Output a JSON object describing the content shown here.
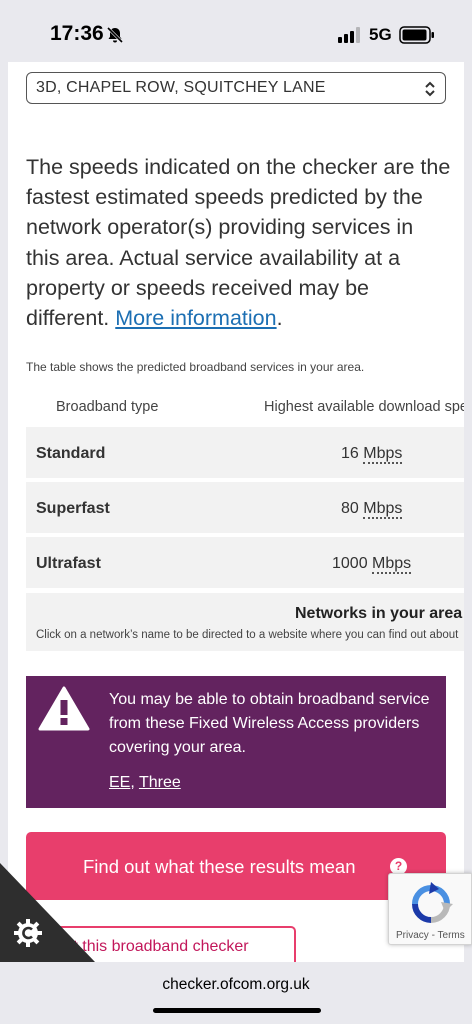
{
  "status_bar": {
    "time": "17:36",
    "network": "5G",
    "icons": [
      "bell-off-icon",
      "signal-icon",
      "battery-icon"
    ]
  },
  "address_select": {
    "value": "3D, CHAPEL ROW, SQUITCHEY LANE"
  },
  "intro": {
    "text": "The speeds indicated on the checker are the fastest estimated speeds predicted by the network operator(s) providing services in this area. Actual service availability at a property or speeds received may be different.",
    "link": "More information",
    "trailing": "."
  },
  "table": {
    "caption": "The table shows the predicted broadband services in your area.",
    "headers": [
      "Broadband type",
      "Highest available download speed"
    ],
    "rows": [
      {
        "type": "Standard",
        "speed": "16",
        "unit": "Mbps"
      },
      {
        "type": "Superfast",
        "speed": "80",
        "unit": "Mbps"
      },
      {
        "type": "Ultrafast",
        "speed": "1000",
        "unit": "Mbps"
      }
    ],
    "networks_title": "Networks in your area",
    "networks_sub": "Click on a network’s name to be directed to a website where you can find out about"
  },
  "fwa_notice": {
    "text": "You may be able to obtain broadband service from these Fixed Wireless Access providers covering your area.",
    "providers": [
      "EE",
      "Three"
    ],
    "separator": ", "
  },
  "buttons": {
    "results": "Find out what these results mean",
    "about": "About this broadband checker"
  },
  "recaptcha": {
    "privacy": "Privacy",
    "sep": " - ",
    "terms": "Terms"
  },
  "browser": {
    "url": "checker.ofcom.org.uk"
  },
  "colors": {
    "accent_pink": "#e83e6c",
    "notice_purple": "#63235f",
    "link_blue": "#1c6fb3"
  }
}
